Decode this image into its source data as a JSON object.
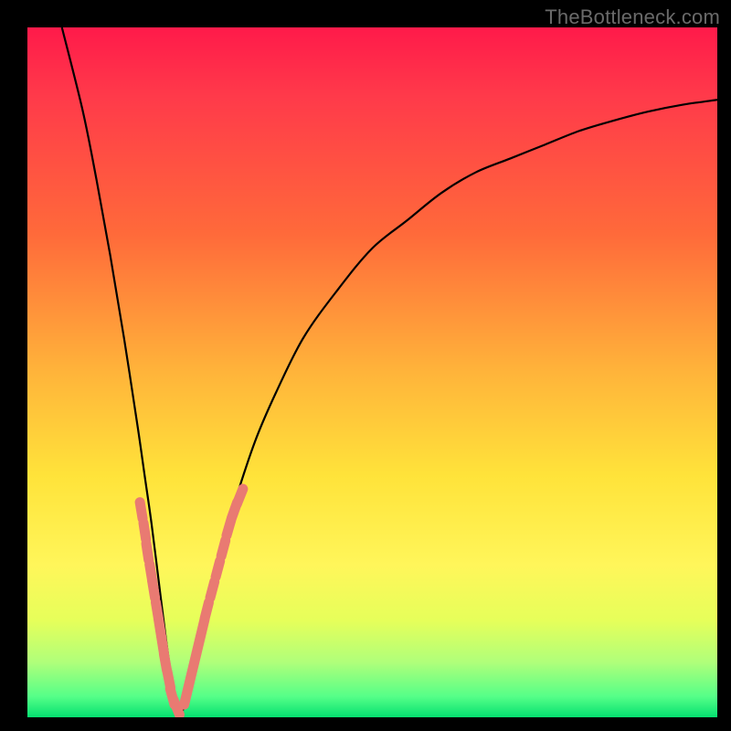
{
  "watermark": "TheBottleneck.com",
  "colors": {
    "frame": "#000000",
    "curve": "#000000",
    "marker": "#e97a72",
    "gradient_stops": [
      "#ff1a4a",
      "#ff3a4a",
      "#ff6a3a",
      "#ffb43a",
      "#ffe33a",
      "#fff65a",
      "#e6ff5a",
      "#b0ff7a",
      "#55ff88",
      "#05e070"
    ]
  },
  "chart_data": {
    "type": "line",
    "title": "",
    "xlabel": "",
    "ylabel": "",
    "xlim": [
      0,
      100
    ],
    "ylim": [
      0,
      100
    ],
    "x_min_at": 22,
    "series": [
      {
        "name": "bottleneck-curve",
        "x": [
          5,
          8,
          10,
          12,
          14,
          16,
          17,
          18,
          19,
          20,
          21,
          22,
          23,
          24,
          25,
          26,
          28,
          30,
          33,
          36,
          40,
          45,
          50,
          55,
          60,
          65,
          70,
          75,
          80,
          85,
          90,
          95,
          100
        ],
        "y": [
          100,
          88,
          78,
          67,
          55,
          42,
          35,
          28,
          20,
          12,
          5,
          1,
          2,
          6,
          11,
          16,
          24,
          31,
          40,
          47,
          55,
          62,
          68,
          72,
          76,
          79,
          81,
          83,
          85,
          86.5,
          87.8,
          88.8,
          89.5
        ]
      }
    ],
    "markers": {
      "name": "highlighted-points",
      "left_branch": {
        "x": [
          16.5,
          17.0,
          17.4,
          17.9,
          18.3,
          18.8,
          19.2,
          19.6,
          20.0,
          20.5,
          21.0,
          21.6
        ],
        "y": [
          30.0,
          27.0,
          24.0,
          21.0,
          18.5,
          15.5,
          13.0,
          10.5,
          8.0,
          5.5,
          3.0,
          1.5
        ]
      },
      "right_branch": {
        "x": [
          23.0,
          23.6,
          24.2,
          24.8,
          25.4,
          26.0,
          26.8,
          27.6,
          28.4,
          29.2,
          30.0,
          30.8
        ],
        "y": [
          3.0,
          5.5,
          8.0,
          10.5,
          13.0,
          15.5,
          18.5,
          21.5,
          24.5,
          27.5,
          30.0,
          32.0
        ]
      }
    }
  }
}
